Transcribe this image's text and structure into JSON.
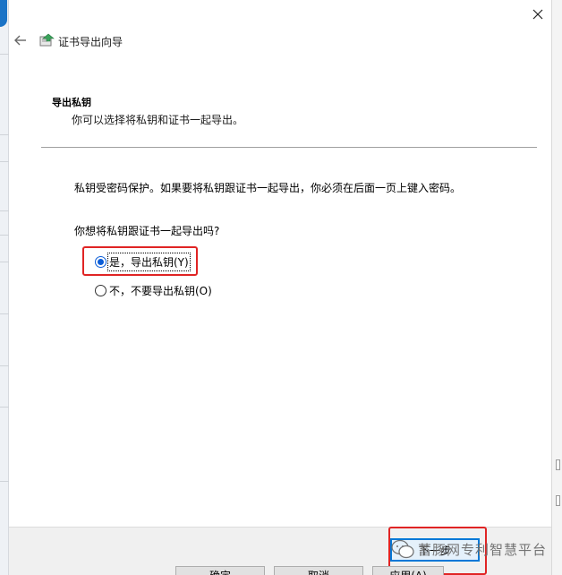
{
  "window": {
    "title": "证书导出向导"
  },
  "header": {
    "section_title": "导出私钥",
    "section_description": "你可以选择将私钥和证书一起导出。"
  },
  "content": {
    "info_text": "私钥受密码保护。如果要将私钥跟证书一起导出，你必须在后面一页上键入密码。",
    "question": "你想将私钥跟证书一起导出吗?",
    "options": [
      {
        "label": "是，导出私钥(Y)",
        "selected": true
      },
      {
        "label": "不，不要导出私钥(O)",
        "selected": false
      }
    ]
  },
  "footer": {
    "next_label": "下一步",
    "ok_label": "确定",
    "cancel_label": "取消",
    "apply_label": "应用(A)"
  },
  "watermark": {
    "text": "蓄豚网专利智慧平台"
  },
  "icons": {
    "close": "close-icon",
    "back": "back-arrow-icon",
    "title": "certificate-icon"
  },
  "colors": {
    "accent": "#0b5dd7",
    "highlight": "#e02424",
    "default_button_border": "#0078d7"
  }
}
